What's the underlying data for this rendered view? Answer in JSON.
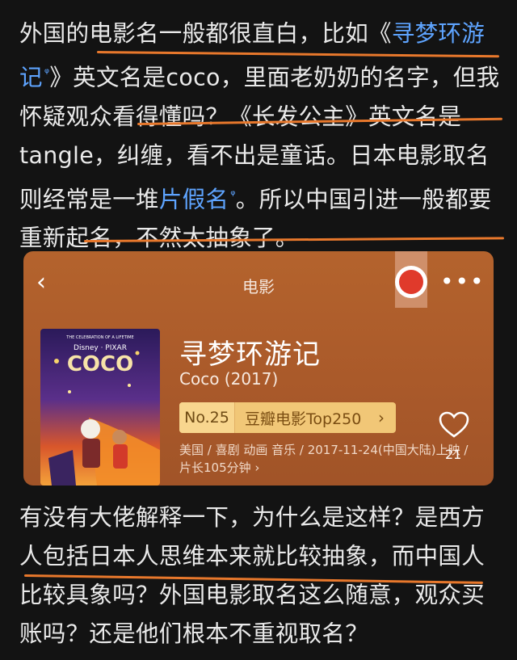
{
  "post": {
    "p1_a": "外国的电影名一般都很直白，比如《",
    "p1_link1": "寻梦环游记",
    "p1_b": "》英文名是coco，里面老奶奶的名字，但我怀疑观众看得懂吗？《长发公主》英文名是tangle，纠缠，看不出是童话。日本电影取名则经常是一堆",
    "p1_link2": "片假名",
    "p1_c": "。所以中国引进一般都要重新起名，不然太抽象了。",
    "search_glyph": "ᵠ",
    "p2": "有没有大佬解释一下，为什么是这样？是西方人包括日本人思维本来就比较抽象，而中国人比较具象吗？外国电影取名这么随意，观众买账吗？还是他们根本不重视取名？"
  },
  "card": {
    "header_title": "电影",
    "back_glyph": "‹",
    "more_glyph": "•••",
    "movie_title": "寻梦环游记",
    "movie_subtitle": "Coco (2017)",
    "rank_no": "No.25",
    "rank_label": "豆瓣电影Top250",
    "rank_arrow": "›",
    "meta": "美国 / 喜剧 动画 音乐 / 2017-11-24(中国大陆)上映 / 片长105分钟 ›",
    "like_count": "21",
    "poster_tagline": "THE CELEBRATION OF A LIFETIME",
    "poster_brand": "Disney · PIXAR",
    "poster_title": "COCO"
  },
  "colors": {
    "link": "#5ea4ff",
    "underline": "#e8782c",
    "card_bg": "#b4632d",
    "rank_bg": "#f1c777"
  },
  "icons": [
    "back-chevron-icon",
    "more-dots-icon",
    "heart-icon",
    "search-superscript-icon",
    "logo-seal"
  ]
}
